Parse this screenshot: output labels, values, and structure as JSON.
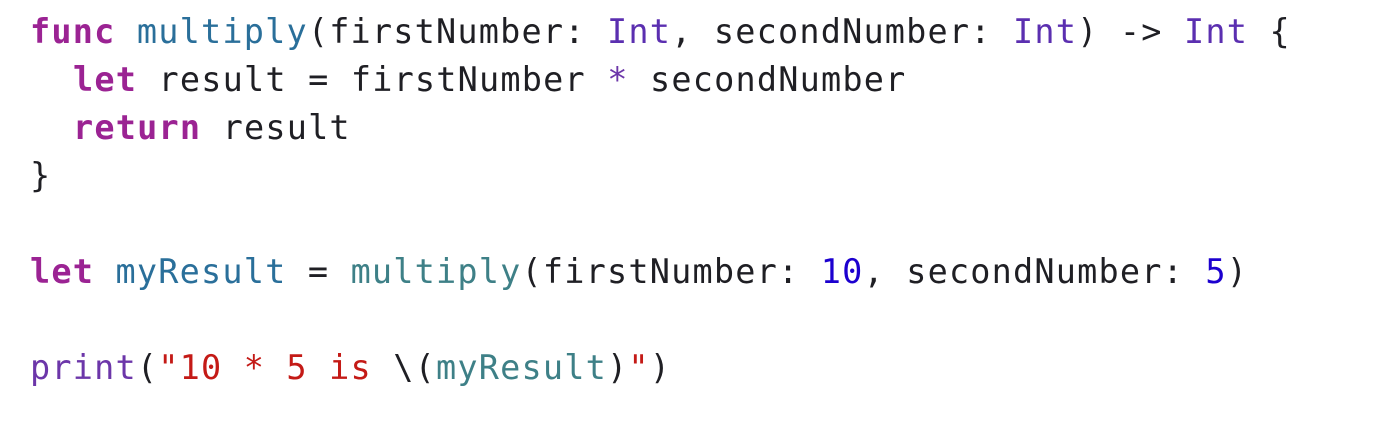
{
  "code": {
    "line1": {
      "kw_func": "func",
      "fn_name": "multiply",
      "p_open": "(",
      "param1": "firstNumber",
      "colon1": ":",
      "type1": "Int",
      "comma1": ",",
      "param2": "secondNumber",
      "colon2": ":",
      "type2": "Int",
      "p_close": ")",
      "arrow": "->",
      "ret_type": "Int",
      "brace_open": "{"
    },
    "line2": {
      "kw_let": "let",
      "var": "result",
      "eq": "=",
      "lhs": "firstNumber",
      "op": "*",
      "rhs": "secondNumber"
    },
    "line3": {
      "kw_return": "return",
      "value": "result"
    },
    "line4": {
      "brace_close": "}"
    },
    "line6": {
      "kw_let": "let",
      "var": "myResult",
      "eq": "=",
      "fn_call": "multiply",
      "p_open": "(",
      "label1": "firstNumber",
      "colon1": ":",
      "num1": "10",
      "comma": ",",
      "label2": "secondNumber",
      "colon2": ":",
      "num2": "5",
      "p_close": ")"
    },
    "line8": {
      "fn_print": "print",
      "p_open": "(",
      "str_start": "\"10 * 5 is ",
      "interp_open": "\\(",
      "interp_var": "myResult",
      "interp_close": ")",
      "str_end": "\"",
      "p_close": ")"
    }
  },
  "colors": {
    "keyword": "#9b2393",
    "function_declaration": "#2a6f9a",
    "function_call": "#3e8087",
    "type": "#5b2fb0",
    "number": "#1c00cf",
    "string": "#c41a16",
    "plain": "#1f1f24"
  }
}
